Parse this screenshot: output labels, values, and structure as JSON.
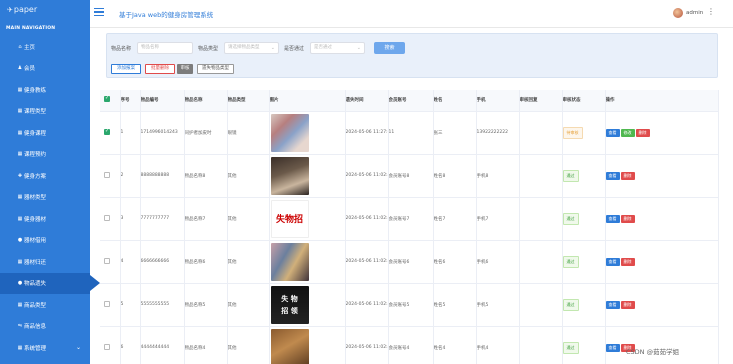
{
  "sidebar": {
    "logo_text": "paper",
    "caption": "MAIN NAVIGATION",
    "items": [
      {
        "label": "主页",
        "icon": "home-icon",
        "glyph": "⌂"
      },
      {
        "label": "会员",
        "icon": "user-icon",
        "glyph": "♟"
      },
      {
        "label": "健身教练",
        "icon": "grid-icon",
        "glyph": "▦"
      },
      {
        "label": "课程类型",
        "icon": "grid-icon",
        "glyph": "▦"
      },
      {
        "label": "健身课程",
        "icon": "grid-icon",
        "glyph": "▦"
      },
      {
        "label": "课程预约",
        "icon": "grid-icon",
        "glyph": "▦"
      },
      {
        "label": "健身方案",
        "icon": "dumbbell-icon",
        "glyph": "✚"
      },
      {
        "label": "器材类型",
        "icon": "grid-icon",
        "glyph": "▦"
      },
      {
        "label": "健身器材",
        "icon": "grid-icon",
        "glyph": "▦"
      },
      {
        "label": "器材借用",
        "icon": "pin-icon",
        "glyph": "●"
      },
      {
        "label": "器材归还",
        "icon": "grid-icon",
        "glyph": "▦"
      },
      {
        "label": "物品遗失",
        "icon": "pin-icon",
        "glyph": "●",
        "active": true
      },
      {
        "label": "商品类型",
        "icon": "grid-icon",
        "glyph": "▦"
      },
      {
        "label": "商品信息",
        "icon": "cart-icon",
        "glyph": "⇋"
      },
      {
        "label": "系统管理",
        "icon": "grid-icon",
        "glyph": "▦",
        "chevron": "⌄"
      }
    ]
  },
  "header": {
    "title": "基于Java web的健身房管理系统",
    "username": "admin",
    "menu_glyph": "⋮"
  },
  "search": {
    "name_label": "物品名称",
    "name_placeholder": "物品名称",
    "type_label": "物品类型",
    "type_placeholder": "请选择物品类型",
    "review_label": "是否通过",
    "review_placeholder": "是否通过",
    "search_button": "搜索",
    "add_button": "添加报案",
    "batch_delete_button": "批量删除",
    "review_button": "审核",
    "print_button": "遗失物品类型"
  },
  "table": {
    "headers": [
      "",
      "序号",
      "物品编号",
      "物品名称",
      "物品类型",
      "图片",
      "遗失时间",
      "会员账号",
      "姓名",
      "手机",
      "审核回复",
      "审核状态",
      "操作"
    ],
    "rows": [
      {
        "checked": true,
        "index": "1",
        "code": "1714996014243",
        "name": "同护者加皮时",
        "type": "眼镜",
        "time": "2024-05-06 11:27:04",
        "account": "11",
        "person": "张三",
        "phone": "13922222222",
        "reply": "",
        "status": "待审核",
        "status_kind": "pending",
        "img": "img-1",
        "has_edit": true
      },
      {
        "checked": false,
        "index": "2",
        "code": "8888888888",
        "name": "物品名称8",
        "type": "其他",
        "time": "2024-05-06 11:02:40",
        "account": "会员账号8",
        "person": "姓名8",
        "phone": "手机8",
        "reply": "",
        "status": "通过",
        "status_kind": "ok",
        "img": "img-2",
        "has_edit": false
      },
      {
        "checked": false,
        "index": "3",
        "code": "7777777777",
        "name": "物品名称7",
        "type": "其他",
        "time": "2024-05-06 11:02:40",
        "account": "会员账号7",
        "person": "姓名7",
        "phone": "手机7",
        "reply": "",
        "status": "通过",
        "status_kind": "ok",
        "img": "img-3",
        "has_edit": false
      },
      {
        "checked": false,
        "index": "4",
        "code": "6666666666",
        "name": "物品名称6",
        "type": "其他",
        "time": "2024-05-06 11:02:40",
        "account": "会员账号6",
        "person": "姓名6",
        "phone": "手机6",
        "reply": "",
        "status": "通过",
        "status_kind": "ok",
        "img": "img-4",
        "has_edit": false
      },
      {
        "checked": false,
        "index": "5",
        "code": "5555555555",
        "name": "物品名称5",
        "type": "其他",
        "time": "2024-05-06 11:02:40",
        "account": "会员账号5",
        "person": "姓名5",
        "phone": "手机5",
        "reply": "",
        "status": "通过",
        "status_kind": "ok",
        "img": "img-5",
        "has_edit": false
      },
      {
        "checked": false,
        "index": "6",
        "code": "4444444444",
        "name": "物品名称4",
        "type": "其他",
        "time": "2024-05-06 11:02:40",
        "account": "会员账号4",
        "person": "姓名4",
        "phone": "手机4",
        "reply": "",
        "status": "通过",
        "status_kind": "ok",
        "img": "img-6",
        "has_edit": false
      }
    ],
    "actions": {
      "view": "查看",
      "edit": "修改",
      "delete": "删除"
    }
  },
  "watermark": "CSDN @茹茹学姐",
  "colors": {
    "primary": "#2f7cd8",
    "active": "#1f64bd",
    "danger": "#e04b4b",
    "success": "#4fb84f"
  }
}
